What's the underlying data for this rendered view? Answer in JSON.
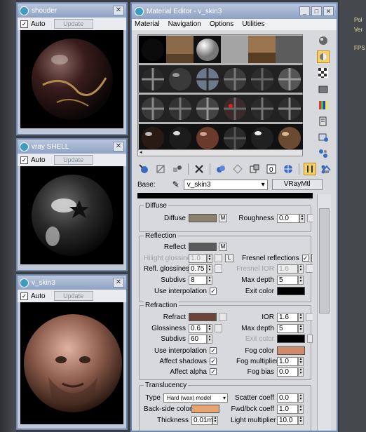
{
  "viewport": {
    "overlay_text": [
      "Pol",
      "Ver",
      "FPS"
    ]
  },
  "previews": [
    {
      "title": "shouder",
      "auto_label": "Auto",
      "update_label": "Update"
    },
    {
      "title": "vray SHELL",
      "auto_label": "Auto",
      "update_label": "Update"
    },
    {
      "title": "v_skin3",
      "auto_label": "Auto",
      "update_label": "Update"
    }
  ],
  "editor": {
    "title": "Material Editor - v_skin3",
    "menu": [
      "Material",
      "Navigation",
      "Options",
      "Utilities"
    ],
    "base_label": "Base:",
    "material_name": "v_skin3",
    "material_type": "VRayMtl"
  },
  "diffuse": {
    "group_label": "Diffuse",
    "diffuse_label": "Diffuse",
    "diffuse_color": "#8b7f6d",
    "m_label": "M",
    "roughness_label": "Roughness",
    "roughness_value": "0.0"
  },
  "reflection": {
    "group_label": "Reflection",
    "reflect_label": "Reflect",
    "reflect_color": "#5a5a5a",
    "m_label": "M",
    "hilight_label": "Hilight glossiness",
    "hilight_value": "1.0",
    "l_label": "L",
    "fresnel_label": "Fresnel reflections",
    "fresnel_checked": "✓",
    "refl_gloss_label": "Refl. glossiness",
    "refl_gloss_value": "0.75",
    "fresnel_ior_label": "Fresnel IOR",
    "fresnel_ior_value": "1.6",
    "subdivs_label": "Subdivs",
    "subdivs_value": "8",
    "max_depth_label": "Max depth",
    "max_depth_value": "5",
    "use_interp_label": "Use interpolation",
    "use_interp_checked": "✓",
    "exit_color_label": "Exit color",
    "exit_color": "#000000"
  },
  "refraction": {
    "group_label": "Refraction",
    "refract_label": "Refract",
    "refract_color": "#6a4436",
    "ior_label": "IOR",
    "ior_value": "1.6",
    "glossiness_label": "Glossiness",
    "glossiness_value": "0.6",
    "max_depth_label": "Max depth",
    "max_depth_value": "5",
    "subdivs_label": "Subdivs",
    "subdivs_value": "60",
    "exit_color_label": "Exit color",
    "exit_color": "#000000",
    "use_interp_label": "Use interpolation",
    "use_interp_checked": "✓",
    "fog_color_label": "Fog color",
    "fog_color": "#d08a6a",
    "affect_shadows_label": "Affect shadows",
    "affect_shadows_checked": "✓",
    "fog_mult_label": "Fog multiplier",
    "fog_mult_value": "1.0",
    "affect_alpha_label": "Affect alpha",
    "affect_alpha_checked": "✓",
    "fog_bias_label": "Fog bias",
    "fog_bias_value": "0.0"
  },
  "translucency": {
    "group_label": "Translucency",
    "type_label": "Type",
    "type_value": "Hard (wax) model",
    "scatter_label": "Scatter coeff",
    "scatter_value": "0.0",
    "backside_label": "Back-side color",
    "backside_color": "#e6a36f",
    "fwd_label": "Fwd/bck coeff",
    "fwd_value": "1.0",
    "thickness_label": "Thickness",
    "thickness_value": "0.01m",
    "light_mult_label": "Light multiplier",
    "light_mult_value": "10.0"
  },
  "icons": {
    "vertical_tools": [
      "sphere-type-icon",
      "backlight-icon",
      "checker-background-icon",
      "sample-uv-tiling-icon",
      "video-color-check-icon",
      "make-preview-icon",
      "options-icon",
      "select-by-material-icon",
      "material-map-navigator-icon"
    ],
    "horizontal_tools": [
      "get-material-icon",
      "put-to-scene-icon",
      "assign-material-icon",
      "reset-map-icon",
      "make-copy-icon",
      "make-unique-icon",
      "put-to-library-icon",
      "material-effects-channel-icon",
      "show-map-in-viewport-icon",
      "show-end-result-icon",
      "go-to-parent-icon",
      "go-forward-to-sibling-icon"
    ]
  }
}
